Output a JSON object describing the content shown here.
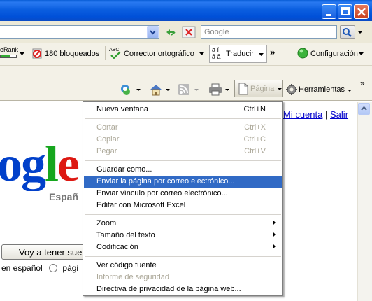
{
  "address_bar": {
    "search_placeholder": "Google"
  },
  "toolbar_google": {
    "pagerank_label": "eRank",
    "blocked_label": "180 bloqueados",
    "spellcheck_label": "Corrector ortográfico",
    "translate_label": "Traducir",
    "overflow_label": "»",
    "settings_label": "Configuración"
  },
  "command_bar": {
    "page_label": "Página",
    "tools_label": "Herramientas",
    "overflow_label": "»"
  },
  "page": {
    "account_link": "Mi cuenta",
    "separator": "|",
    "signout_link": "Salir",
    "logo_text": "oogle",
    "country_label": "Españ",
    "lucky_button": "Voy a tener suerte",
    "lang_spanish": "en español",
    "lang_pages": "pági"
  },
  "menu": {
    "items": [
      {
        "label": "Nueva ventana",
        "shortcut": "Ctrl+N",
        "state": "enabled"
      },
      {
        "label": "Cortar",
        "shortcut": "Ctrl+X",
        "state": "disabled"
      },
      {
        "label": "Copiar",
        "shortcut": "Ctrl+C",
        "state": "disabled"
      },
      {
        "label": "Pegar",
        "shortcut": "Ctrl+V",
        "state": "disabled"
      },
      {
        "label": "Guardar como...",
        "shortcut": "",
        "state": "enabled"
      },
      {
        "label": "Enviar la página por correo electrónico...",
        "shortcut": "",
        "state": "selected"
      },
      {
        "label": "Enviar vínculo por correo electrónico...",
        "shortcut": "",
        "state": "enabled"
      },
      {
        "label": "Editar con Microsoft Excel",
        "shortcut": "",
        "state": "enabled"
      },
      {
        "label": "Zoom",
        "shortcut": "",
        "state": "submenu"
      },
      {
        "label": "Tamaño del texto",
        "shortcut": "",
        "state": "submenu"
      },
      {
        "label": "Codificación",
        "shortcut": "",
        "state": "submenu"
      },
      {
        "label": "Ver código fuente",
        "shortcut": "",
        "state": "enabled"
      },
      {
        "label": "Informe de seguridad",
        "shortcut": "",
        "state": "disabled"
      },
      {
        "label": "Directiva de privacidad de la página web...",
        "shortcut": "",
        "state": "enabled"
      }
    ]
  },
  "colors": {
    "titlebar": "#0b5fe0",
    "menu_highlight": "#316ac5",
    "link": "#0000cc",
    "disabled_text": "#aca899"
  }
}
